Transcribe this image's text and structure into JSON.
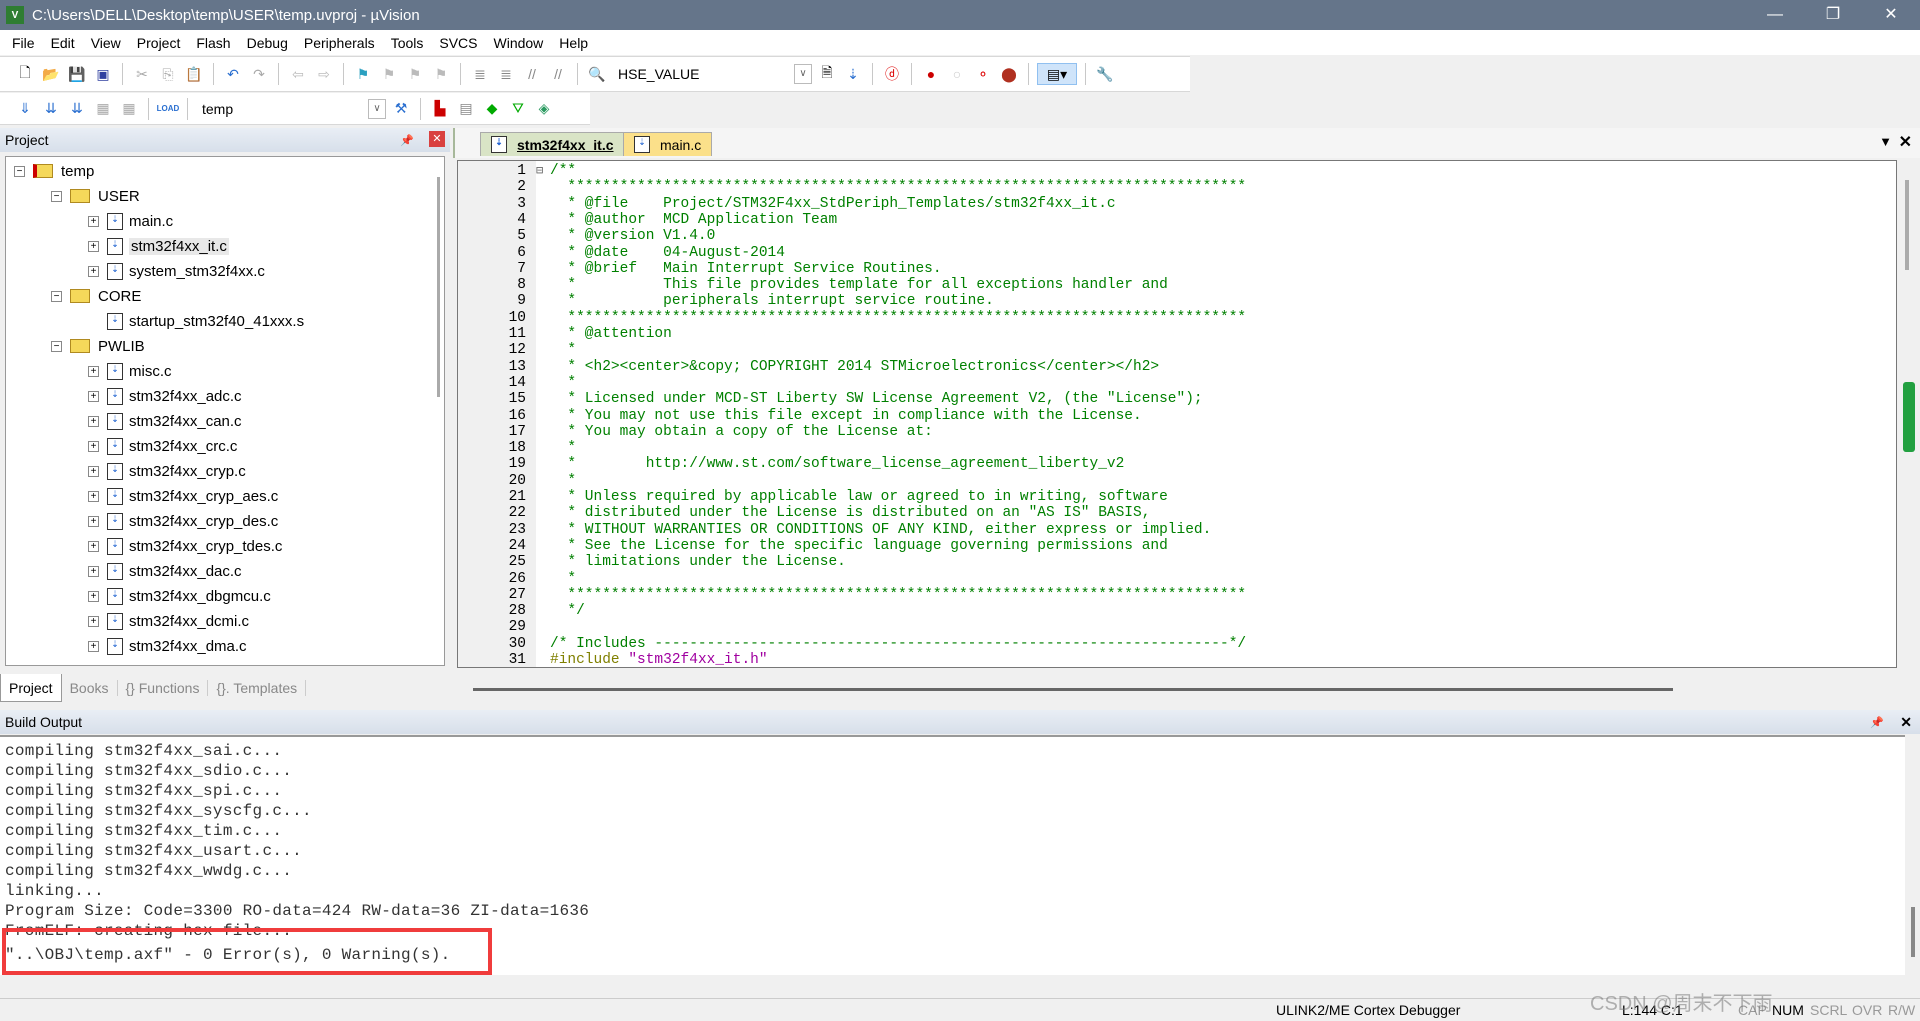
{
  "window": {
    "title": "C:\\Users\\DELL\\Desktop\\temp\\USER\\temp.uvproj - µVision",
    "minimize": "—",
    "restore": "❐",
    "close": "✕"
  },
  "menu": [
    "File",
    "Edit",
    "View",
    "Project",
    "Flash",
    "Debug",
    "Peripherals",
    "Tools",
    "SVCS",
    "Window",
    "Help"
  ],
  "toolbar": {
    "find_combo": "HSE_VALUE",
    "target_combo": "temp",
    "load_label": "LOAD"
  },
  "project_panel": {
    "title": "Project",
    "pin": "📌",
    "close": "✕",
    "tree": [
      {
        "label": "temp",
        "level": 0,
        "kind": "project",
        "expander": "−"
      },
      {
        "label": "USER",
        "level": 1,
        "kind": "folder",
        "expander": "−"
      },
      {
        "label": "main.c",
        "level": 2,
        "kind": "file",
        "expander": "+"
      },
      {
        "label": "stm32f4xx_it.c",
        "level": 2,
        "kind": "file",
        "expander": "+",
        "selected": true
      },
      {
        "label": "system_stm32f4xx.c",
        "level": 2,
        "kind": "file",
        "expander": "+"
      },
      {
        "label": "CORE",
        "level": 1,
        "kind": "folder",
        "expander": "−"
      },
      {
        "label": "startup_stm32f40_41xxx.s",
        "level": 2,
        "kind": "file",
        "expander": ""
      },
      {
        "label": "PWLIB",
        "level": 1,
        "kind": "folder",
        "expander": "−"
      },
      {
        "label": "misc.c",
        "level": 2,
        "kind": "file",
        "expander": "+"
      },
      {
        "label": "stm32f4xx_adc.c",
        "level": 2,
        "kind": "file",
        "expander": "+"
      },
      {
        "label": "stm32f4xx_can.c",
        "level": 2,
        "kind": "file",
        "expander": "+"
      },
      {
        "label": "stm32f4xx_crc.c",
        "level": 2,
        "kind": "file",
        "expander": "+"
      },
      {
        "label": "stm32f4xx_cryp.c",
        "level": 2,
        "kind": "file",
        "expander": "+"
      },
      {
        "label": "stm32f4xx_cryp_aes.c",
        "level": 2,
        "kind": "file",
        "expander": "+"
      },
      {
        "label": "stm32f4xx_cryp_des.c",
        "level": 2,
        "kind": "file",
        "expander": "+"
      },
      {
        "label": "stm32f4xx_cryp_tdes.c",
        "level": 2,
        "kind": "file",
        "expander": "+"
      },
      {
        "label": "stm32f4xx_dac.c",
        "level": 2,
        "kind": "file",
        "expander": "+"
      },
      {
        "label": "stm32f4xx_dbgmcu.c",
        "level": 2,
        "kind": "file",
        "expander": "+"
      },
      {
        "label": "stm32f4xx_dcmi.c",
        "level": 2,
        "kind": "file",
        "expander": "+"
      },
      {
        "label": "stm32f4xx_dma.c",
        "level": 2,
        "kind": "file",
        "expander": "+"
      }
    ],
    "tabs": [
      "Project",
      "Books",
      "{} Functions",
      "{}. Templates"
    ]
  },
  "editor": {
    "tabs": [
      {
        "label": "stm32f4xx_it.c",
        "active": true
      },
      {
        "label": "main.c",
        "active": false
      }
    ],
    "lines": [
      "/**",
      "  ******************************************************************************",
      "  * @file    Project/STM32F4xx_StdPeriph_Templates/stm32f4xx_it.c",
      "  * @author  MCD Application Team",
      "  * @version V1.4.0",
      "  * @date    04-August-2014",
      "  * @brief   Main Interrupt Service Routines.",
      "  *          This file provides template for all exceptions handler and",
      "  *          peripherals interrupt service routine.",
      "  ******************************************************************************",
      "  * @attention",
      "  *",
      "  * <h2><center>&copy; COPYRIGHT 2014 STMicroelectronics</center></h2>",
      "  *",
      "  * Licensed under MCD-ST Liberty SW License Agreement V2, (the \"License\");",
      "  * You may not use this file except in compliance with the License.",
      "  * You may obtain a copy of the License at:",
      "  *",
      "  *        http://www.st.com/software_license_agreement_liberty_v2",
      "  *",
      "  * Unless required by applicable law or agreed to in writing, software",
      "  * distributed under the License is distributed on an \"AS IS\" BASIS,",
      "  * WITHOUT WARRANTIES OR CONDITIONS OF ANY KIND, either express or implied.",
      "  * See the License for the specific language governing permissions and",
      "  * limitations under the License.",
      "  *",
      "  ******************************************************************************",
      "  */",
      "",
      "/* Includes ------------------------------------------------------------------*/",
      "#include \"stm32f4xx_it.h\"",
      ""
    ],
    "colors": {
      "comment": "#008000",
      "preprocessor": "#808000",
      "string": "#a000a0"
    }
  },
  "build_output": {
    "title": "Build Output",
    "lines": [
      "compiling stm32f4xx_sai.c...",
      "compiling stm32f4xx_sdio.c...",
      "compiling stm32f4xx_spi.c...",
      "compiling stm32f4xx_syscfg.c...",
      "compiling stm32f4xx_tim.c...",
      "compiling stm32f4xx_usart.c...",
      "compiling stm32f4xx_wwdg.c...",
      "linking...",
      "Program Size: Code=3300 RO-data=424 RW-data=36 ZI-data=1636",
      "FromELF: creating hex file...",
      "\"..\\OBJ\\temp.axf\" - 0 Error(s), 0 Warning(s)."
    ],
    "highlight_color": "#f03c3c"
  },
  "status": {
    "debugger": "ULINK2/ME Cortex Debugger",
    "position": "L:144 C:1",
    "cap": "CAP",
    "num": "NUM",
    "scrl": "SCRL",
    "ovr": "OVR",
    "rw": "R/W",
    "watermark": "CSDN @周末不下雨"
  }
}
